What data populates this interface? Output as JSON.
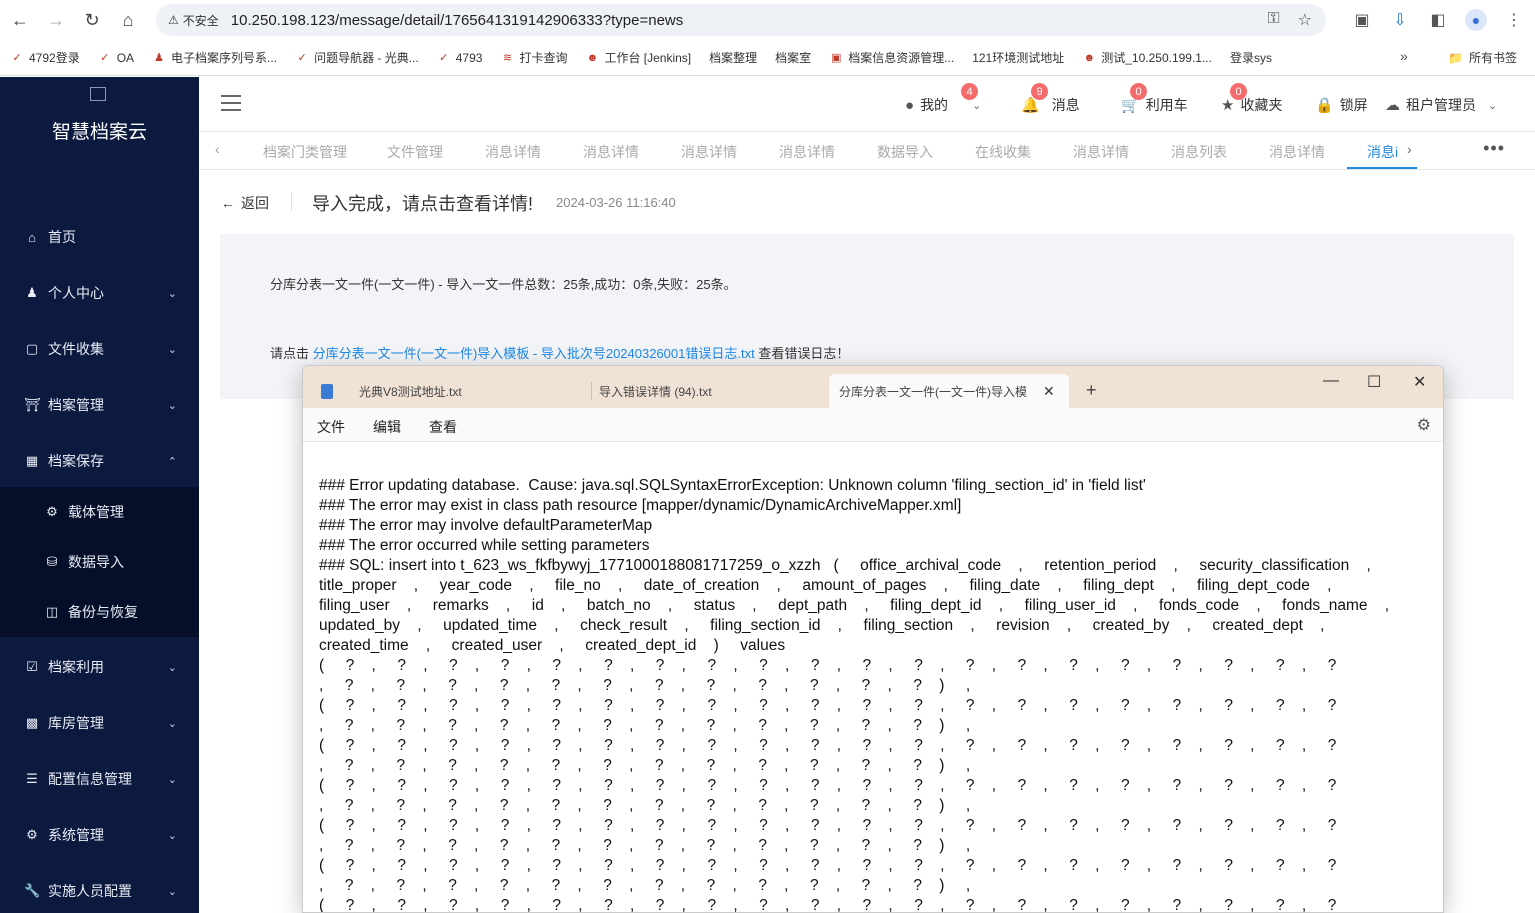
{
  "browser": {
    "security_label": "不安全",
    "url": "10.250.198.123/message/detail/1765641319142906333?type=news",
    "bookmarks": [
      {
        "label": "4792登录",
        "icon": "code-icon"
      },
      {
        "label": "OA",
        "icon": "code-icon"
      },
      {
        "label": "电子档案序列号系...",
        "icon": "person-icon"
      },
      {
        "label": "问题导航器 - 光典...",
        "icon": "code-icon"
      },
      {
        "label": "4793",
        "icon": "code-icon"
      },
      {
        "label": "打卡查询",
        "icon": "link-icon"
      },
      {
        "label": "工作台 [Jenkins]",
        "icon": "jenkins-icon"
      },
      {
        "label": "档案整理",
        "icon": "none"
      },
      {
        "label": "档案室",
        "icon": "none"
      },
      {
        "label": "档案信息资源管理...",
        "icon": "image-icon"
      },
      {
        "label": "121环境测试地址",
        "icon": "none"
      },
      {
        "label": "测试_10.250.199.1...",
        "icon": "jenkins-icon"
      },
      {
        "label": "登录sys",
        "icon": "none"
      }
    ],
    "more": "»",
    "all_bookmarks": "所有书签"
  },
  "sidebar": {
    "logo_title": "智慧档案云",
    "items": [
      {
        "label": "首页",
        "icon": "home-icon"
      },
      {
        "label": "个人中心",
        "icon": "user-icon"
      },
      {
        "label": "文件收集",
        "icon": "inbox-icon"
      },
      {
        "label": "档案管理",
        "icon": "bank-icon"
      },
      {
        "label": "档案保存",
        "icon": "save-icon"
      },
      {
        "label": "档案利用",
        "icon": "clipboard-icon"
      },
      {
        "label": "库房管理",
        "icon": "building-icon"
      },
      {
        "label": "配置信息管理",
        "icon": "config-icon"
      },
      {
        "label": "系统管理",
        "icon": "gear-icon"
      },
      {
        "label": "实施人员配置",
        "icon": "wrench-icon"
      }
    ],
    "subitems": [
      {
        "label": "载体管理",
        "icon": "cog-icon"
      },
      {
        "label": "数据导入",
        "icon": "database-icon"
      },
      {
        "label": "备份与恢复",
        "icon": "backup-icon"
      }
    ]
  },
  "header": {
    "mine": "我的",
    "mine_badge": "4",
    "messages": "消息",
    "messages_badge": "9",
    "cart": "利用车",
    "cart_badge": "0",
    "favorites": "收藏夹",
    "favorites_badge": "0",
    "lock": "锁屏",
    "tenant": "租户管理员"
  },
  "tabs": [
    "档案门类管理",
    "文件管理",
    "消息详情",
    "消息详情",
    "消息详情",
    "消息详情",
    "数据导入",
    "在线收集",
    "消息详情",
    "消息列表",
    "消息详情",
    "消息i"
  ],
  "message": {
    "back": "返回",
    "title": "导入完成，请点击查看详情!",
    "time": "2024-03-26 11:16:40",
    "line1": "分库分表一文一件(一文一件) - 导入一文一件总数：25条,成功：0条,失败：25条。",
    "line2_prefix": "请点击 ",
    "line2_link": "分库分表一文一件(一文一件)导入模板 - 导入批次号20240326001错误日志.txt",
    "line2_suffix": " 查看错误日志！"
  },
  "notepad": {
    "tabs": [
      "光典V8测试地址.txt",
      "导入错误详情 (94).txt",
      "分库分表一文一件(一文一件)导入模"
    ],
    "menu": [
      "文件",
      "编辑",
      "查看"
    ],
    "lines": [
      "### Error updating database.  Cause: java.sql.SQLSyntaxErrorException: Unknown column 'filing_section_id' in 'field list'",
      "### The error may exist in class path resource [mapper/dynamic/DynamicArchiveMapper.xml]",
      "### The error may involve defaultParameterMap",
      "### The error occurred while setting parameters",
      "### SQL: insert into t_623_ws_fkfbywyj_1771000188081717259_o_xzzh   (     office_archival_code    ,     retention_period    ,     security_classification    ,",
      "title_proper    ,     year_code    ,     file_no    ,     date_of_creation    ,     amount_of_pages    ,     filing_date    ,     filing_dept    ,     filing_dept_code    ,",
      "filing_user    ,     remarks    ,     id    ,     batch_no    ,     status    ,     dept_path    ,     filing_dept_id    ,     filing_user_id    ,     fonds_code    ,     fonds_name    ,",
      "updated_by    ,     updated_time    ,     check_result    ,     filing_section_id    ,     filing_section    ,     revision    ,     created_by    ,     created_dept    ,",
      "created_time    ,     created_user    ,     created_dept_id    )     values",
      "(     ?    ,     ?    ,     ?    ,     ?    ,     ?    ,     ?    ,     ?    ,     ?    ,     ?    ,     ?    ,     ?    ,     ?    ,     ?    ,     ?    ,     ?    ,     ?    ,     ?    ,     ?    ,     ?    ,     ?",
      ",     ?    ,     ?    ,     ?    ,     ?    ,     ?    ,     ?    ,     ?    ,     ?    ,     ?    ,     ?    ,     ?    ,     ?    )     ,",
      "(     ?    ,     ?    ,     ?    ,     ?    ,     ?    ,     ?    ,     ?    ,     ?    ,     ?    ,     ?    ,     ?    ,     ?    ,     ?    ,     ?    ,     ?    ,     ?    ,     ?    ,     ?    ,     ?    ,     ?",
      ",     ?    ,     ?    ,     ?    ,     ?    ,     ?    ,     ?    ,     ?    ,     ?    ,     ?    ,     ?    ,     ?    ,     ?    )     ,",
      "(     ?    ,     ?    ,     ?    ,     ?    ,     ?    ,     ?    ,     ?    ,     ?    ,     ?    ,     ?    ,     ?    ,     ?    ,     ?    ,     ?    ,     ?    ,     ?    ,     ?    ,     ?    ,     ?    ,     ?",
      ",     ?    ,     ?    ,     ?    ,     ?    ,     ?    ,     ?    ,     ?    ,     ?    ,     ?    ,     ?    ,     ?    ,     ?    )     ,",
      "(     ?    ,     ?    ,     ?    ,     ?    ,     ?    ,     ?    ,     ?    ,     ?    ,     ?    ,     ?    ,     ?    ,     ?    ,     ?    ,     ?    ,     ?    ,     ?    ,     ?    ,     ?    ,     ?    ,     ?",
      ",     ?    ,     ?    ,     ?    ,     ?    ,     ?    ,     ?    ,     ?    ,     ?    ,     ?    ,     ?    ,     ?    ,     ?    )     ,",
      "(     ?    ,     ?    ,     ?    ,     ?    ,     ?    ,     ?    ,     ?    ,     ?    ,     ?    ,     ?    ,     ?    ,     ?    ,     ?    ,     ?    ,     ?    ,     ?    ,     ?    ,     ?    ,     ?    ,     ?",
      ",     ?    ,     ?    ,     ?    ,     ?    ,     ?    ,     ?    ,     ?    ,     ?    ,     ?    ,     ?    ,     ?    ,     ?    )     ,",
      "(     ?    ,     ?    ,     ?    ,     ?    ,     ?    ,     ?    ,     ?    ,     ?    ,     ?    ,     ?    ,     ?    ,     ?    ,     ?    ,     ?    ,     ?    ,     ?    ,     ?    ,     ?    ,     ?    ,     ?",
      ",     ?    ,     ?    ,     ?    ,     ?    ,     ?    ,     ?    ,     ?    ,     ?    ,     ?    ,     ?    ,     ?    ,     ?    )     ,",
      "(     ?    ,     ?    ,     ?    ,     ?    ,     ?    ,     ?    ,     ?    ,     ?    ,     ?    ,     ?    ,     ?    ,     ?    ,     ?    ,     ?    ,     ?    ,     ?    ,     ?    ,     ?    ,     ?    ,     ?"
    ]
  },
  "colors": {
    "sidebar_bg": "#0d1a3f",
    "accent": "#1e88e5",
    "badge": "#f56c6c"
  }
}
